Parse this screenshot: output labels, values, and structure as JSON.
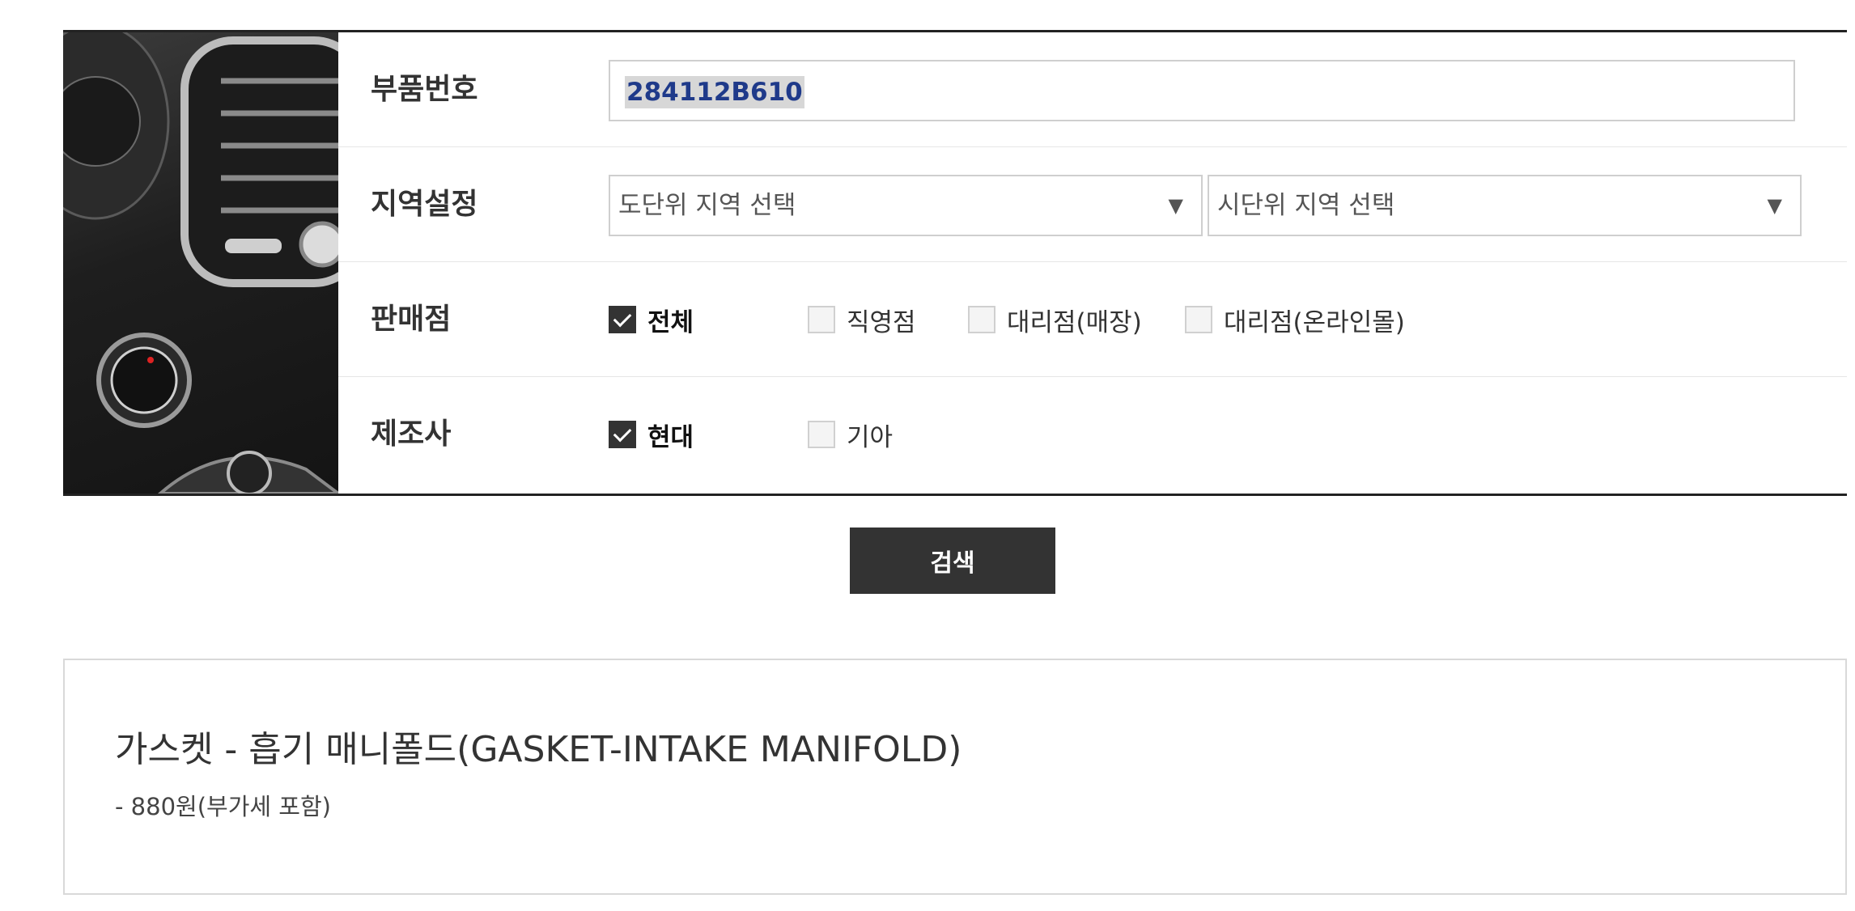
{
  "form": {
    "part_number": {
      "label": "부품번호",
      "value": "284112B610"
    },
    "region": {
      "label": "지역설정",
      "province_select": "도단위 지역 선택",
      "city_select": "시단위 지역 선택"
    },
    "dealer": {
      "label": "판매점",
      "options": [
        {
          "label": "전체",
          "checked": true
        },
        {
          "label": "직영점",
          "checked": false
        },
        {
          "label": "대리점(매장)",
          "checked": false
        },
        {
          "label": "대리점(온라인몰)",
          "checked": false
        }
      ]
    },
    "manufacturer": {
      "label": "제조사",
      "options": [
        {
          "label": "현대",
          "checked": true
        },
        {
          "label": "기아",
          "checked": false
        }
      ]
    }
  },
  "search_button": {
    "label": "검색"
  },
  "result": {
    "title": "가스켓 - 흡기 매니폴드(GASKET-INTAKE MANIFOLD)",
    "price": "- 880원(부가세 포함)"
  },
  "colors": {
    "selection_text": "#1f3a8a",
    "button_bg": "#333333",
    "border": "#cfcfcf"
  }
}
